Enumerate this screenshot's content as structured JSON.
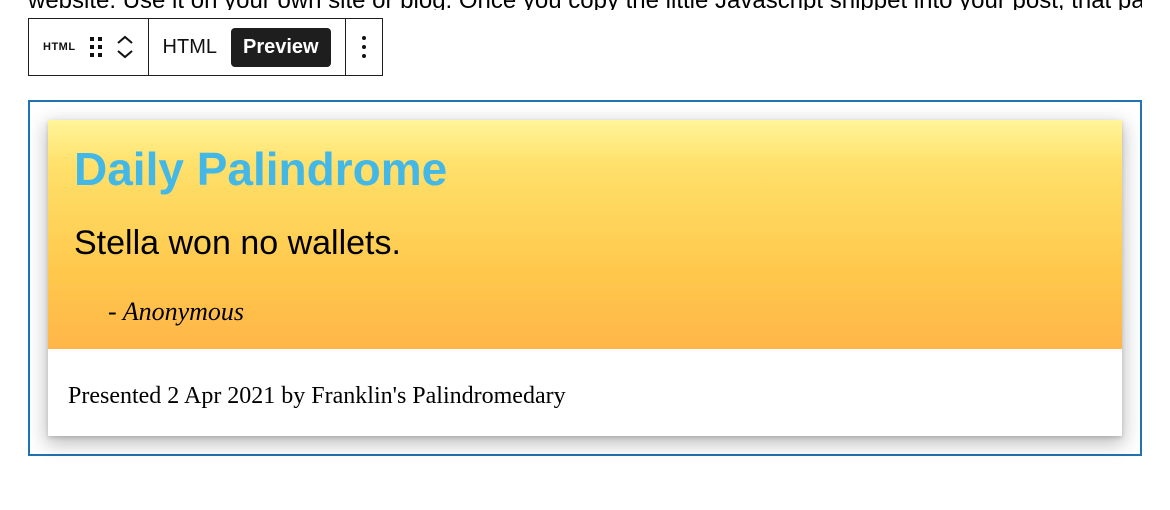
{
  "context_text": "website. Use it on your own site or blog. Once you copy the little Javascript snippet into your post, that page will",
  "toolbar": {
    "block_type_chip": "HTML",
    "mode_html_label": "HTML",
    "mode_preview_label": "Preview"
  },
  "widget": {
    "title": "Daily Palindrome",
    "palindrome_text": "Stella won no wallets.",
    "attribution": "- Anonymous",
    "footer": "Presented 2 Apr 2021 by Franklin's Palindromedary"
  }
}
